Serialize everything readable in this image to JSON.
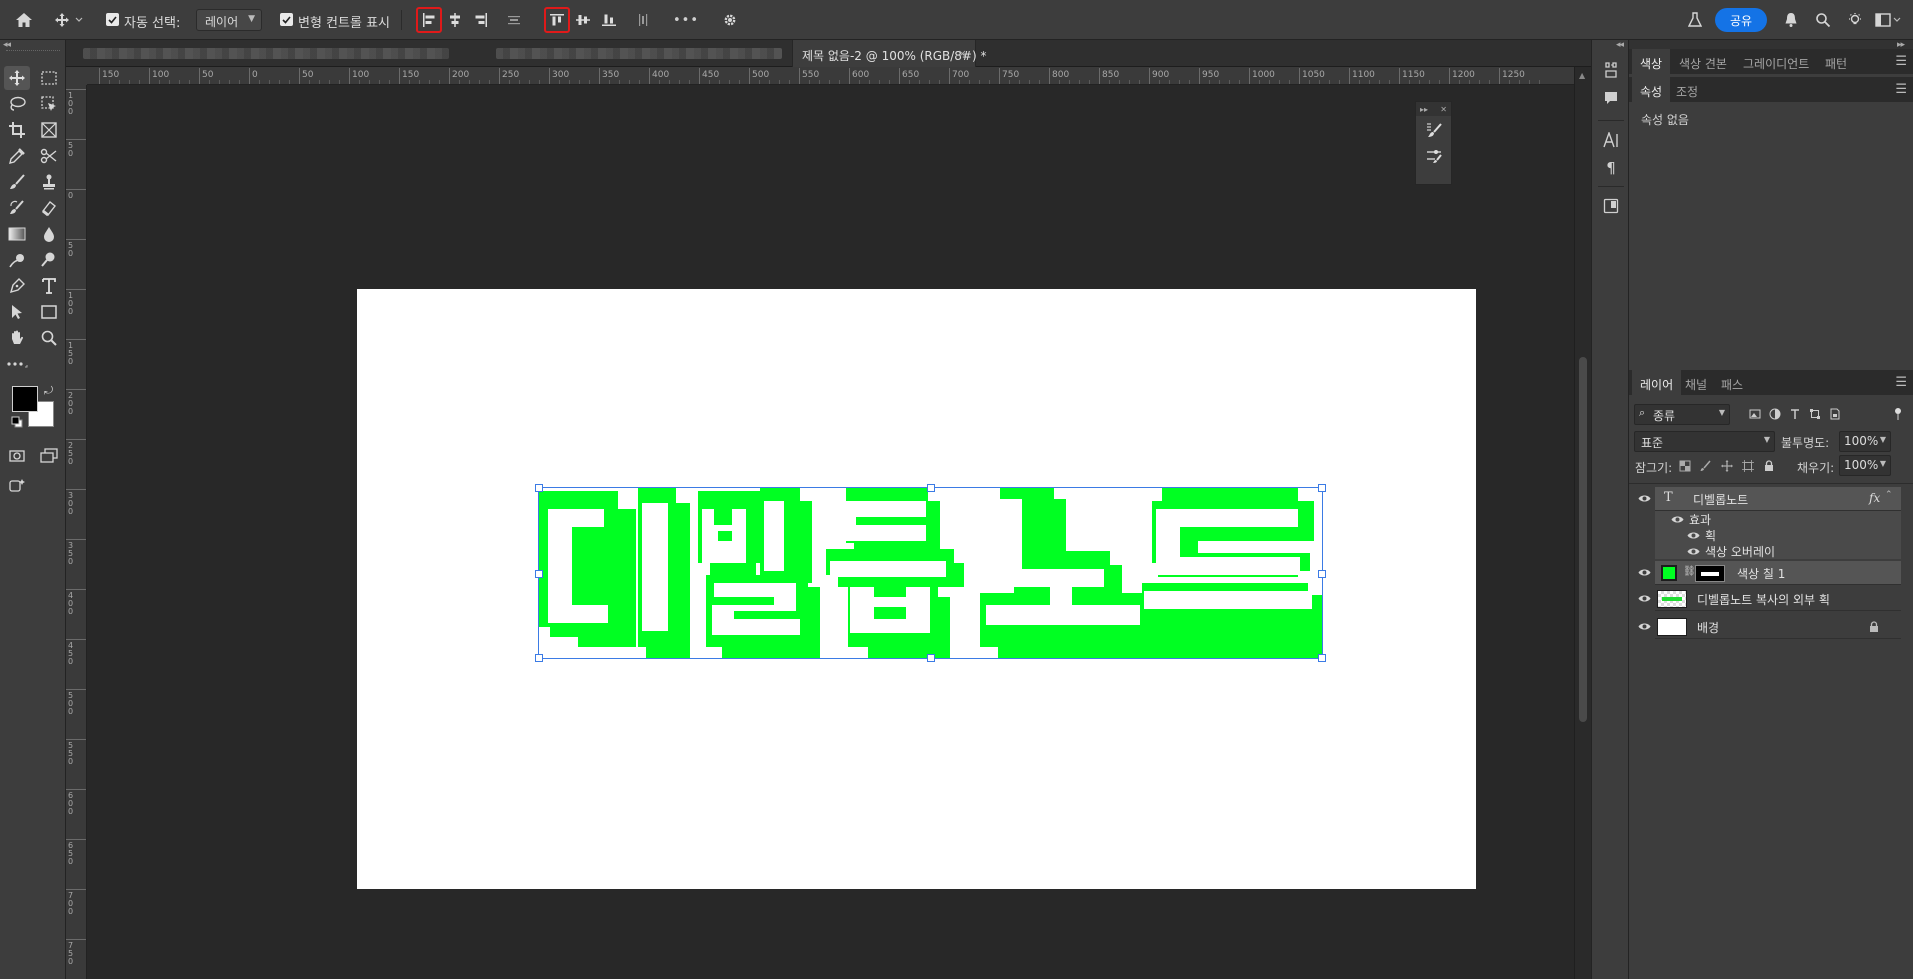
{
  "options_bar": {
    "auto_select_label": "자동 선택:",
    "auto_select_value": "레이어",
    "transform_label": "변형 컨트롤 표시",
    "more_label": "•••",
    "share_label": "공유"
  },
  "document": {
    "tab_title": "제목 없음-2 @ 100% (RGB/8#) *",
    "tab_close": "×",
    "artwork_text": "디벨롭노트",
    "artwork_color": "#00ff22"
  },
  "rulers": {
    "h_labels": [
      "150",
      "100",
      "50",
      "0",
      "50",
      "100",
      "150",
      "200",
      "250",
      "300",
      "350",
      "400",
      "450",
      "500",
      "550",
      "600",
      "650",
      "700",
      "750",
      "800",
      "850",
      "900",
      "950",
      "1000",
      "1050",
      "1100",
      "1150",
      "1200",
      "1250"
    ],
    "v_labels": [
      "100",
      "50",
      "0",
      "50",
      "100",
      "150",
      "200",
      "250",
      "300",
      "350",
      "400",
      "450",
      "500",
      "550",
      "600",
      "650",
      "700",
      "750"
    ]
  },
  "color_panel": {
    "tabs": [
      "색상",
      "색상 견본",
      "그레이디언트",
      "패턴"
    ],
    "active_tab": "색상"
  },
  "properties_panel": {
    "tabs": [
      "속성",
      "조정"
    ],
    "active_tab": "속성",
    "empty_text": "속성 없음"
  },
  "layers_panel": {
    "tabs": [
      "레이어",
      "채널",
      "패스"
    ],
    "active_tab": "레이어",
    "filter_label": "종류",
    "blend_mode": "표준",
    "opacity_label": "불투명도:",
    "opacity_value": "100%",
    "lock_label": "잠그기:",
    "fill_label": "채우기:",
    "fill_value": "100%",
    "layers": [
      {
        "name": "디벨롭노트",
        "type": "text",
        "fx": "fx"
      },
      {
        "name": "효과"
      },
      {
        "name": "획"
      },
      {
        "name": "색상 오버레이"
      },
      {
        "name": "색상 칠 1",
        "fill_color": "#00ff22"
      },
      {
        "name": "디벨롭노트 복사의 외부 획"
      },
      {
        "name": "배경"
      }
    ]
  }
}
